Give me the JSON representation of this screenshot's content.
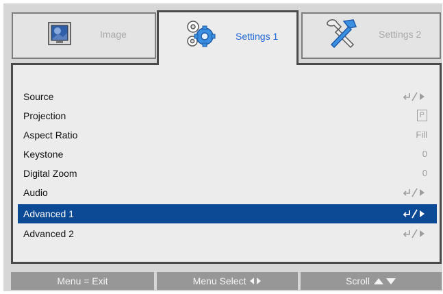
{
  "tabs": [
    {
      "label": "Image",
      "icon": "image-icon",
      "active": false
    },
    {
      "label": "Settings 1",
      "icon": "gears-icon",
      "active": true
    },
    {
      "label": "Settings 2",
      "icon": "tools-icon",
      "active": false
    }
  ],
  "menu": {
    "items": [
      {
        "label": "Source",
        "value_type": "enter-arrow-icon"
      },
      {
        "label": "Projection",
        "value": "P"
      },
      {
        "label": "Aspect Ratio",
        "value": "Fill"
      },
      {
        "label": "Keystone",
        "value": "0"
      },
      {
        "label": "Digital Zoom",
        "value": "0"
      },
      {
        "label": "Audio",
        "value_type": "enter-arrow-icon"
      },
      {
        "label": "Advanced 1",
        "value_type": "enter-arrow-icon",
        "selected": true
      },
      {
        "label": "Advanced 2",
        "value_type": "enter-arrow-icon"
      }
    ]
  },
  "footer": {
    "exit": "Menu = Exit",
    "select": "Menu Select",
    "scroll": "Scroll"
  },
  "colors": {
    "selection": "#0c4a95",
    "active_tab_text": "#1c67d6",
    "inactive_text": "#a8a8a8",
    "footer_button": "#979797"
  }
}
